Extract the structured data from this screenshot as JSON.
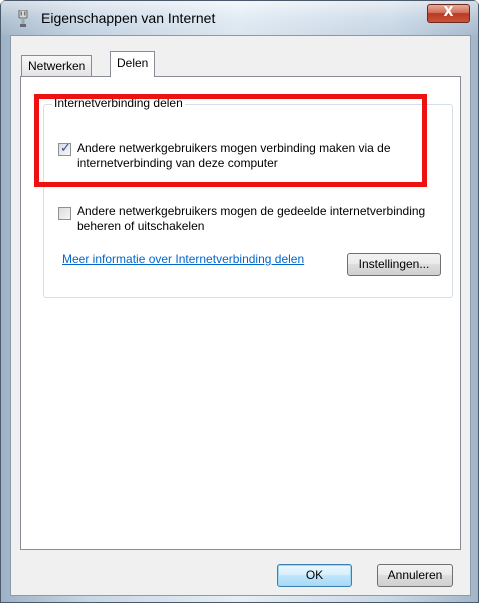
{
  "window": {
    "title": "Eigenschappen van Internet",
    "close_label": "X"
  },
  "tabs": [
    {
      "label": "Netwerken",
      "selected": false
    },
    {
      "label": "Delen",
      "selected": true
    }
  ],
  "sharing": {
    "group_label": "Internetverbinding delen",
    "allow_connect": {
      "label": "Andere netwerkgebruikers mogen verbinding maken via de internetverbinding van deze computer",
      "checked": true
    },
    "allow_control": {
      "label": "Andere netwerkgebruikers mogen de gedeelde internetverbinding beheren of uitschakelen",
      "checked": false
    },
    "info_link": "Meer informatie over Internetverbinding delen",
    "settings_button": "Instellingen..."
  },
  "footer": {
    "ok_label": "OK",
    "cancel_label": "Annuleren"
  },
  "annotation": {
    "highlight_color": "#ee1111"
  }
}
